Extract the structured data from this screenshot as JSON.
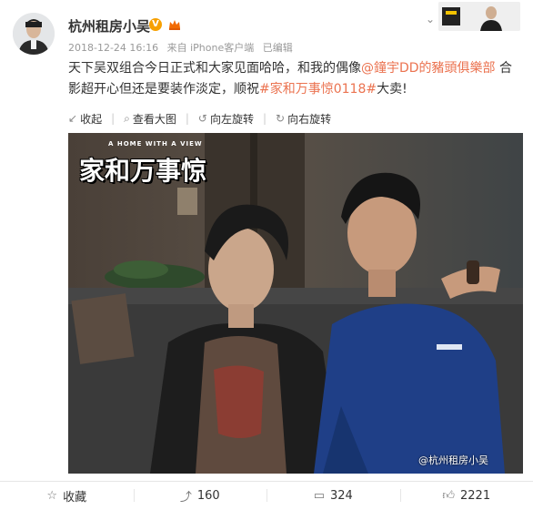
{
  "user": {
    "name": "杭州租房小吴",
    "verified_mark": "V"
  },
  "post": {
    "timestamp": "2018-12-24 16:16",
    "source": "来自 iPhone客户端",
    "edited": "已编辑",
    "text_part1": "天下吴双组合今日正式和大家见面哈哈，和我的偶像",
    "mention": "@鐘宇DD的豬頭俱樂部",
    "text_part2": " 合影超开心但还是要装作淡定，顺祝",
    "hashtag": "#家和万事惊0118#",
    "text_part3": "大卖!"
  },
  "toolbar": {
    "collapse": "收起",
    "view_large": "查看大图",
    "rotate_left": "向左旋转",
    "rotate_right": "向右旋转"
  },
  "photo": {
    "title_art": "家和万事惊",
    "tagline": "A HOME WITH A VIEW",
    "watermark": "@杭州租房小吴"
  },
  "footer": {
    "favorite": "收藏",
    "share_count": "160",
    "comment_count": "324",
    "like_count": "2221"
  },
  "icons": {
    "collapse": "collapse-icon",
    "view_large": "magnifier-icon",
    "rotate_left": "rotate-left-icon",
    "rotate_right": "rotate-right-icon",
    "favorite": "star-icon",
    "share": "share-icon",
    "comment": "comment-icon",
    "like": "thumbs-up-icon"
  },
  "colors": {
    "link": "#eb7350",
    "text": "#333333",
    "meta": "#999999",
    "verified": "#f7a000"
  }
}
